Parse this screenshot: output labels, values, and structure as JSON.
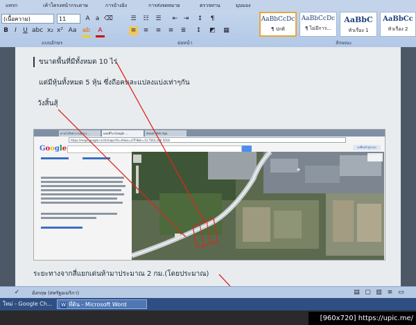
{
  "ribbon": {
    "tabs": [
      "แทรก",
      "เค้าโครงหน้ากระดาษ",
      "การอ้างอิง",
      "การส่งจดหมาย",
      "ตรวจทาน",
      "มุมมอง"
    ],
    "font_name": "(เนื้อความ)",
    "font_size": "11",
    "group_font_label": "แบบอักษร",
    "group_paragraph_label": "ย่อหน้า",
    "group_styles_label": "ลักษณะ",
    "styles": [
      {
        "preview": "AaBbCcDc",
        "name": "¶ ปกติ"
      },
      {
        "preview": "AaBbCcDc",
        "name": "¶ ไม่มีการ..."
      },
      {
        "preview": "AaBbC",
        "name": "หัวเรื่อง 1"
      },
      {
        "preview": "AaBbCc",
        "name": "หัวเรื่อง 2"
      }
    ]
  },
  "document": {
    "line1": "ขนาดพื้นที่มีทั้งหมด 10 ไร่",
    "line2": "แต่มีหุ้นทั้งหมด 5 หุ้น ซึ่งถือคนละแปลงแบ่งเท่าๆกัน",
    "line3": "วังสิ้นสุ้",
    "line4": "ระยะทางจากสี่แยกเด่นห้ามาประมาณ 2 กม.(โดยประมาณ)"
  },
  "embedded": {
    "tabs": [
      "ผ่านไปวิทยาจานนด่าง...",
      "แผนที่ใน Google ...",
      "อัปเดต Web App"
    ],
    "url": "https://maps.google.co.th/maps?hl=th&ie=UTF8&ll=13.7563,100.5018",
    "logo": "Google",
    "search_button": "ค้นหา",
    "right_label": "ลงชื่อเข้าสู่ระบบ"
  },
  "statusbar": {
    "language": "อังกฤษ (สหรัฐอเมริกา)"
  },
  "taskbar": {
    "item1": "ใหม่ - Google Ch...",
    "item2": "ที่ดิน - Microsoft Word"
  },
  "watermark": "[960x720] https://upic.me/",
  "colors": {
    "annotation": "#d8281e",
    "ribbon": "#b2c8e6",
    "taskbar": "#2f4f82"
  }
}
